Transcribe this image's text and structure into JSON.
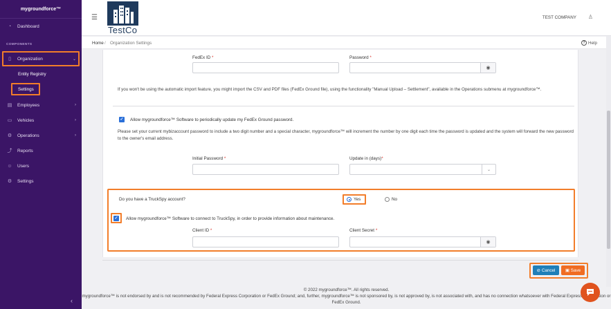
{
  "app": {
    "brand": "mygroundforce™"
  },
  "sidebar": {
    "section_label": "COMPONENTS",
    "items": [
      {
        "label": "Dashboard",
        "icon": "dashboard-icon"
      },
      {
        "label": "Organization",
        "icon": "organization-icon"
      },
      {
        "label": "Employees",
        "icon": "employees-icon"
      },
      {
        "label": "Vehicles",
        "icon": "vehicles-icon"
      },
      {
        "label": "Operations",
        "icon": "operations-icon"
      },
      {
        "label": "Reports",
        "icon": "reports-icon"
      },
      {
        "label": "Users",
        "icon": "users-icon"
      },
      {
        "label": "Settings",
        "icon": "settings-icon"
      }
    ],
    "sub_items": [
      {
        "label": "Entity Registry"
      },
      {
        "label": "Settings"
      }
    ],
    "collapse_glyph": "‹"
  },
  "header": {
    "logo_text": "TestCo",
    "company": "TEST COMPANY"
  },
  "breadcrumb": {
    "home": "Home",
    "separator": "/",
    "current": "Organization Settings",
    "help": "Help"
  },
  "form": {
    "fedex_id_label": "FedEx ID",
    "password_label": "Password",
    "required_mark": "*",
    "manual_upload_note": "If you won't be using the automatic import feature, you might import the CSV and PDF files (FedEx Ground file), using the functionality \"Manual Upload – Settlement\", available in the Operations submenu at mygroundforce™.",
    "auto_update_label": "Allow mygroundforce™ Software to periodically update my FedEx Ground password.",
    "password_policy_note": "Please set your current mybizaccount password to include a two digit number and a special character, mygroundforce™ will increment the number by one digit each time the password is updated and the system will forward the new password to the owner's email address.",
    "initial_password_label": "Initial Password",
    "update_days_label": "Update in (days)",
    "truckspy_question": "Do you have a TruckSpy account?",
    "yes_label": "Yes",
    "no_label": "No",
    "truckspy_allow_label": "Allow mygroundforce™ Software to connect to TruckSpy, in order to provide information about maintenance.",
    "client_id_label": "Client ID",
    "client_secret_label": "Client Secret",
    "cancel_label": "Cancel",
    "save_label": "Save",
    "accent_color": "#f27d2a"
  },
  "footer": {
    "copyright": "© 2022 mygroundforce™. All rights reserved.",
    "disclaimer": "mygroundforce™ is not endorsed by and is not recommended by Federal Express Corporation or FedEx Ground; and, further, mygroundforce™ is not sponsored by, is not approved by, is not associated with, and has no connection whatsoever with Federal Express Corporation or FedEx Ground."
  }
}
